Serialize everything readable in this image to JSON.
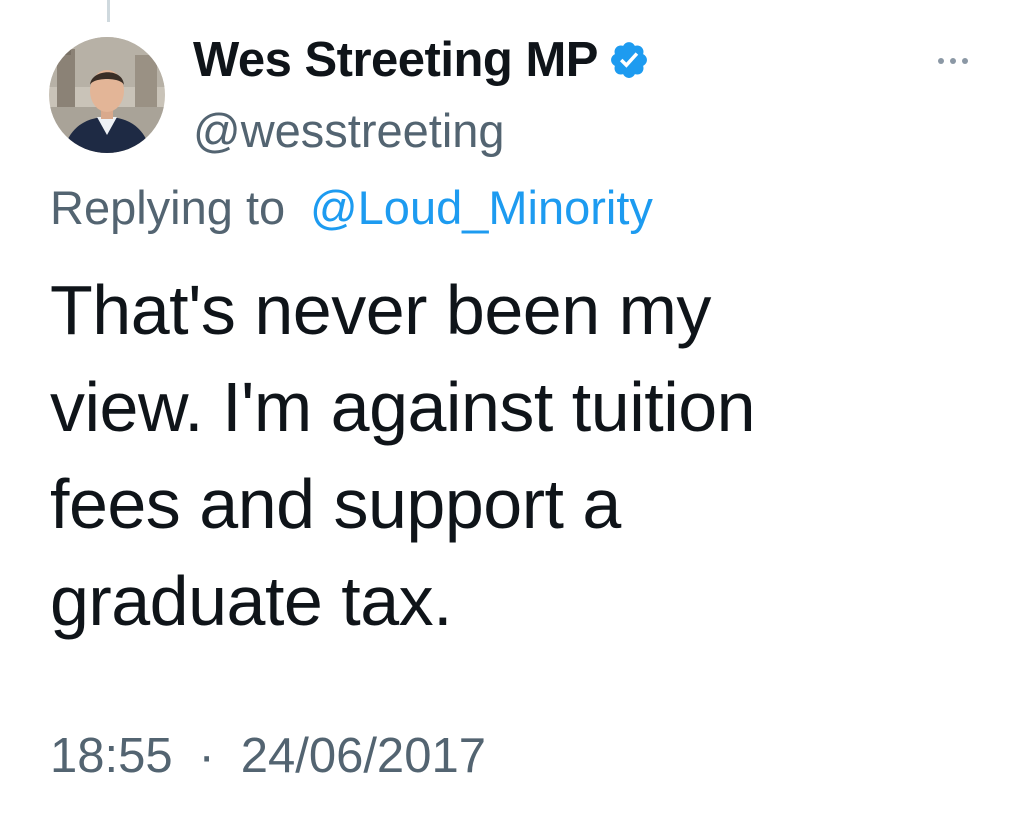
{
  "author": {
    "display_name": "Wes Streeting MP",
    "handle": "@wesstreeting",
    "verified": true,
    "avatar_icon": "profile-photo"
  },
  "reply": {
    "prefix": "Replying to",
    "target": "@Loud_Minority"
  },
  "tweet": {
    "text": "That's never been my\nview. I'm against tuition\nfees and support a\ngraduate tax."
  },
  "meta": {
    "time": "18:55",
    "separator": "·",
    "date": "24/06/2017"
  },
  "icons": {
    "more": "more-horizontal-icon",
    "verified": "verified-badge-icon"
  },
  "colors": {
    "text": "#0f1419",
    "secondary": "#536471",
    "accent": "#1d9bf0"
  }
}
